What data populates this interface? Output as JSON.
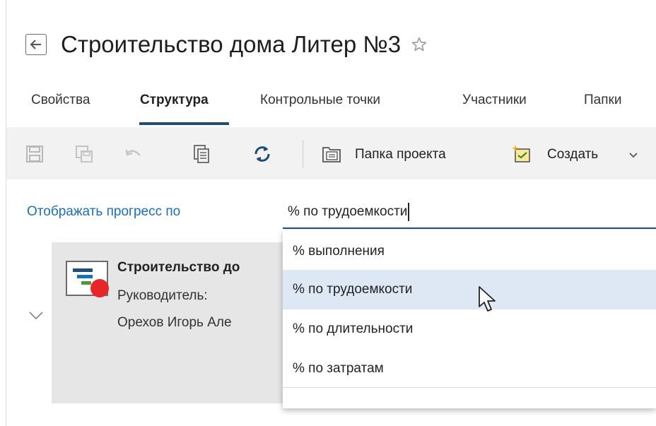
{
  "header": {
    "title": "Строительство дома Литер №3"
  },
  "tabs": [
    {
      "label": "Свойства",
      "active": false
    },
    {
      "label": "Структура",
      "active": true
    },
    {
      "label": "Контрольные точки",
      "active": false
    },
    {
      "label": "Участники",
      "active": false
    },
    {
      "label": "Папки",
      "active": false
    }
  ],
  "toolbar": {
    "project_folder_label": "Папка проекта",
    "create_label": "Создать"
  },
  "progress": {
    "label": "Отображать прогресс по",
    "value": "% по трудоемкости",
    "options": [
      "% выполнения",
      "% по трудоемкости",
      "% по длительности",
      "% по затратам"
    ],
    "highlighted": "% по трудоемкости"
  },
  "card": {
    "title": "Строительство до",
    "manager_label": "Руководитель:",
    "manager_name": "Орехов Игорь Але"
  },
  "colors": {
    "accent": "#1f4e79",
    "link": "#1a6fb5",
    "hover": "#dde8f4",
    "status_red": "#e8262a"
  }
}
